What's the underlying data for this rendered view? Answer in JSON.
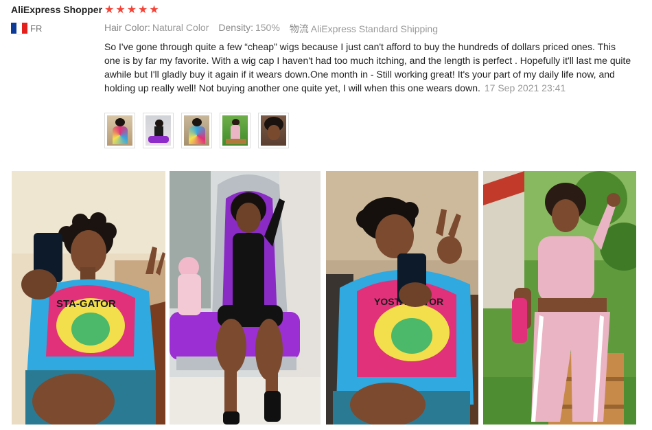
{
  "reviewer": {
    "name": "AliExpress Shopper",
    "rating": 5,
    "country": "FR"
  },
  "icons": {
    "star": "star-icon",
    "flag": "france-flag-icon"
  },
  "attributes": [
    {
      "key": "Hair Color:",
      "value": "Natural Color"
    },
    {
      "key": "Density:",
      "value": "150%"
    },
    {
      "key": "物流",
      "value": "AliExpress Standard Shipping"
    }
  ],
  "review": {
    "text": "So I've gone through quite a few “cheap” wigs because I just can't afford to buy the hundreds of dollars priced ones. This one is by far my favorite. With a wig cap I haven't had too much itching, and the length is perfect . Hopefully it'll last me quite awhile but I'll gladly buy it again if it wears down.One month in - Still working great! It's your part of my daily life now, and holding up really well! Not buying another one quite yet, I will when this one wears down.",
    "date": "17 Sep 2021 23:41"
  },
  "colors": {
    "star": "#f44336",
    "muted": "#999999",
    "text": "#222222"
  },
  "thumbnails": [
    {
      "name": "photo-thumbnail-1"
    },
    {
      "name": "photo-thumbnail-2"
    },
    {
      "name": "photo-thumbnail-3"
    },
    {
      "name": "photo-thumbnail-4"
    },
    {
      "name": "photo-thumbnail-5"
    }
  ],
  "photos": [
    {
      "name": "review-photo-1",
      "shirt_text": "STA-GATOR"
    },
    {
      "name": "review-photo-2"
    },
    {
      "name": "review-photo-3",
      "shirt_text": "YOSTA-GATOR"
    },
    {
      "name": "review-photo-4"
    }
  ]
}
